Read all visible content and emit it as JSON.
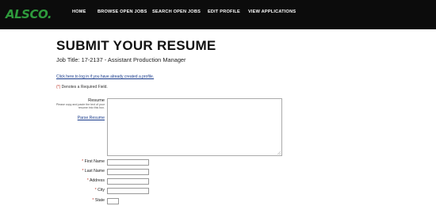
{
  "header": {
    "logo_text": "ALSCO",
    "logo_dot": ".",
    "nav": [
      "HOME",
      "BROWSE OPEN JOBS",
      "SEARCH OPEN JOBS",
      "EDIT PROFILE",
      "VIEW APPLICATIONS"
    ]
  },
  "main": {
    "title": "SUBMIT YOUR RESUME",
    "job_title": "Job Title: 17-2137 - Assistant Production Manager",
    "login_link": "Click here to log in if you have already created a profile.",
    "required_star": "(*)",
    "required_note": " Denotes a Required Field."
  },
  "resume": {
    "label": "Resume",
    "help": "Please copy and paste the text of your resume into this box.",
    "parse_link": "Parse Resume",
    "value": ""
  },
  "fields": [
    {
      "req": "*",
      "label": " First Name",
      "value": ""
    },
    {
      "req": "*",
      "label": " Last Name",
      "value": ""
    },
    {
      "req": "*",
      "label": " Address",
      "value": ""
    },
    {
      "req": "*",
      "label": " City",
      "value": ""
    },
    {
      "req": "*",
      "label": " State",
      "value": ""
    }
  ],
  "colors": {
    "brand_green": "#2e9a3c",
    "header_bg": "#0c0c0c",
    "link": "#1a3c8c",
    "required": "#c0392b"
  }
}
